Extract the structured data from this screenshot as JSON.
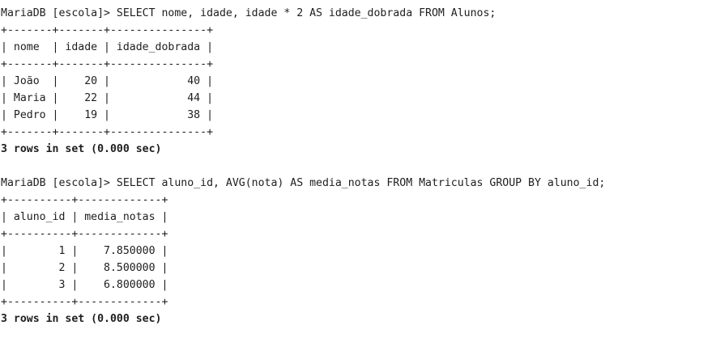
{
  "terminal": {
    "blocks": [
      {
        "command": "MariaDB [escola]> SELECT nome, idade, idade * 2 AS idade_dobrada FROM Alunos;",
        "separator": "+-------+-------+---------------+",
        "header": "| nome  | idade | idade_dobrada |",
        "rows": [
          "| João  |    20 |            40 |",
          "| Maria |    22 |            44 |",
          "| Pedro |    19 |            38 |"
        ],
        "status": "3 rows in set (0.000 sec)"
      },
      {
        "command": "MariaDB [escola]> SELECT aluno_id, AVG(nota) AS media_notas FROM Matriculas GROUP BY aluno_id;",
        "separator": "+----------+-------------+",
        "header": "| aluno_id | media_notas |",
        "rows": [
          "|        1 |    7.850000 |",
          "|        2 |    8.500000 |",
          "|        3 |    6.800000 |"
        ],
        "status": "3 rows in set (0.000 sec)"
      }
    ]
  }
}
